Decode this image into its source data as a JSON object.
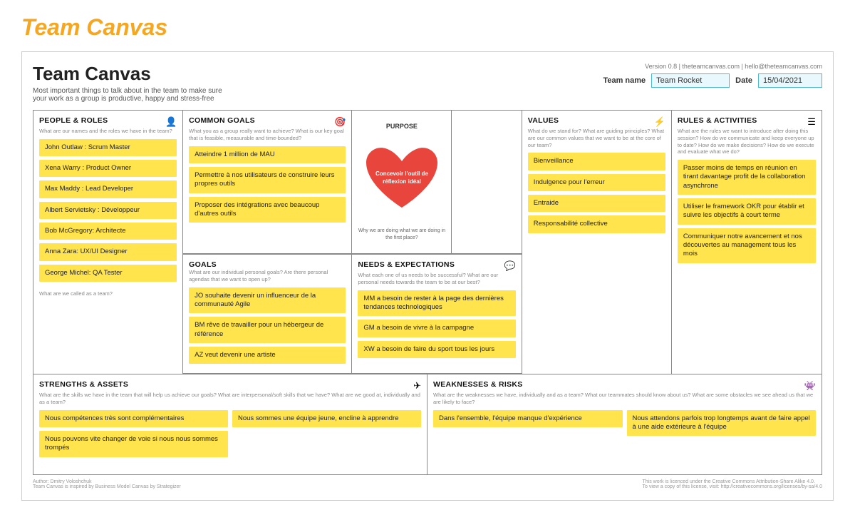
{
  "page": {
    "top_title": "Team Canvas",
    "canvas_title": "Team Canvas",
    "canvas_subtitle": "Most important things to talk about in the team to make sure your work as a group is productive, happy and stress-free",
    "version_info": "Version 0.8  |  theteamcanvas.com  |  hello@theteamcanvas.com",
    "team_name_label": "Team name",
    "team_name_value": "Team Rocket",
    "date_label": "Date",
    "date_value": "15/04/2021"
  },
  "sections": {
    "people": {
      "title": "PEOPLE & ROLES",
      "subtitle": "What are our names and the roles we have in the team?",
      "members": [
        "John Outlaw : Scrum Master",
        "Xena Warry : Product Owner",
        "Max Maddy : Lead Developer",
        "Albert Servietsky : Développeur",
        "Bob McGregory: Architecte",
        "Anna Zara: UX/UI Designer",
        "George Michel: QA Tester"
      ],
      "team_name_prompt": "What are we called as a team?"
    },
    "common_goals": {
      "title": "COMMON GOALS",
      "subtitle": "What you as a group really want to achieve? What is our key goal that is feasible, measurable and time-bounded?",
      "items": [
        "Atteindre 1 million de MAU",
        "Permettre à nos utilisateurs de construire leurs propres outils",
        "Proposer des intégrations avec beaucoup d'autres outils"
      ]
    },
    "purpose": {
      "label": "PURPOSE",
      "inner_text": "Concevoir l'outil de réflexion idéal",
      "text_above": "Why we are doing what",
      "text_below": "we are doing in the first place?"
    },
    "values": {
      "title": "VALUES",
      "subtitle": "What do we stand for? What are guiding principles? What are our common values that we want to be at the core of our team?",
      "items": [
        "Bienveillance",
        "Indulgence pour l'erreur",
        "Entraide",
        "Responsabilité collective"
      ]
    },
    "rules": {
      "title": "RULES & ACTIVITIES",
      "subtitle": "What are the rules we want to introduce after doing this session? How do we communicate and keep everyone up to date? How do we make decisions? How do we execute and evaluate what we do?",
      "items": [
        "Passer moins de temps en réunion en tirant davantage profit de la collaboration asynchrone",
        "Utiliser le framework OKR pour établir et suivre les objectifs à court terme",
        "Communiquer notre avancement et nos découvertes au management tous les mois"
      ]
    },
    "goals": {
      "title": "GOALS",
      "subtitle": "What are our individual personal goals? Are there personal agendas that we want to open up?",
      "items": [
        "JO souhaite devenir un influenceur de la communauté Agile",
        "BM rêve de travailler pour un hébergeur de référence",
        "AZ veut devenir une artiste"
      ]
    },
    "needs": {
      "title": "NEEDS & EXPECTATIONS",
      "subtitle": "What each one of us needs to be successful? What are our personal needs towards the team to be at our best?",
      "items": [
        "MM a besoin de rester à la page des dernières tendances technologiques",
        "GM a besoin de vivre à la campagne",
        "XW a besoin de faire du sport tous les jours"
      ]
    },
    "strengths": {
      "title": "STRENGTHS & ASSETS",
      "subtitle": "What are the skills we have in the team that will help us achieve our goals? What are interpersonal/soft skills that we have? What are we good at, individually and as a team?",
      "items": [
        "Nous compétences très sont complémentaires",
        "Nous pouvons vite changer de voie si nous nous sommes trompés",
        "Nous sommes une équipe jeune, encline à apprendre"
      ]
    },
    "weaknesses": {
      "title": "WEAKNESSES & RISKS",
      "subtitle": "What are the weaknesses we have, individually and as a team? What our teammates should know about us? What are some obstacles we see ahead us that we are likely to face?",
      "items": [
        "Dans l'ensemble, l'équipe manque d'expérience",
        "Nous attendons parfois trop longtemps avant de faire appel à une aide extérieure à l'équipe"
      ]
    }
  },
  "footer": {
    "left": "Author: Dmitry Voloshchuk\nTeam Canvas is inspired by Business Model Canvas by Strategizer",
    "right": "This work is licenced under the Creative Commons Attribution-Share Alike 4.0.\nTo view a copy of this license, visit: http://creativecommons.org/licenses/by-sa/4.0"
  },
  "icons": {
    "people": "👤",
    "goals": "🎯",
    "values": "⚡",
    "rules": "☰",
    "strengths": "✈",
    "weaknesses": "👾"
  }
}
